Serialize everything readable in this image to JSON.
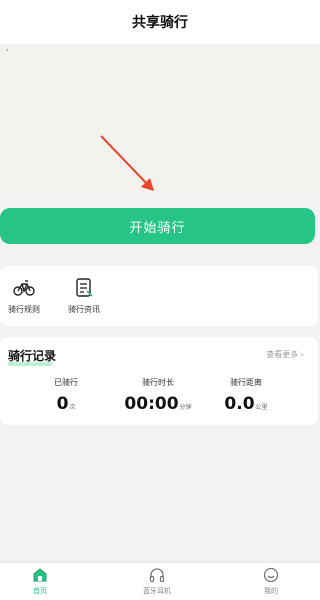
{
  "header": {
    "title": "共享骑行"
  },
  "map": {
    "corner_mark": "·"
  },
  "start_button": {
    "label": "开始骑行"
  },
  "quick_links": [
    {
      "label": "骑行规则",
      "icon": "bicycle-icon"
    },
    {
      "label": "骑行资讯",
      "icon": "document-icon"
    }
  ],
  "record": {
    "title": "骑行记录",
    "more": "查看更多",
    "stats": [
      {
        "label": "已骑行",
        "value": "0",
        "unit": "次"
      },
      {
        "label": "骑行时长",
        "value": "00:00",
        "unit": "分钟"
      },
      {
        "label": "骑行距离",
        "value": "0.0",
        "unit": "公里"
      }
    ]
  },
  "tabs": [
    {
      "label": "首页",
      "icon": "home-icon",
      "active": true
    },
    {
      "label": "蓝牙耳机",
      "icon": "headphones-icon",
      "active": false
    },
    {
      "label": "我的",
      "icon": "profile-icon",
      "active": false
    }
  ],
  "colors": {
    "accent": "#26c486",
    "arrow": "#e8442c",
    "map_bg": "#f4f2ee"
  }
}
